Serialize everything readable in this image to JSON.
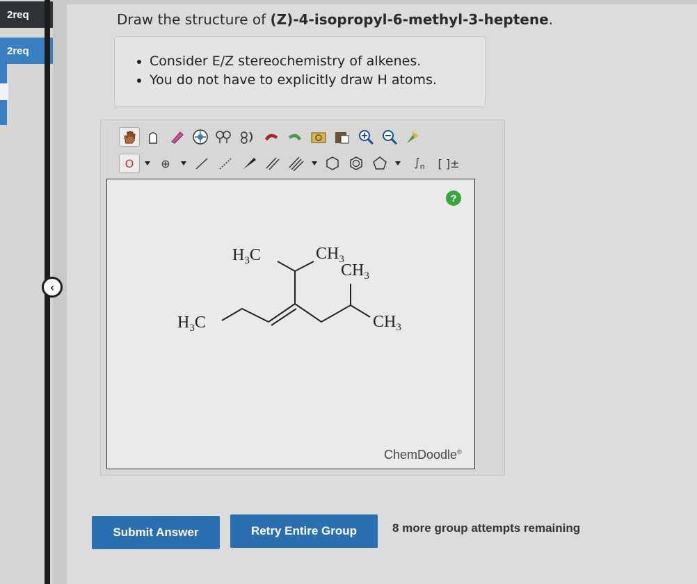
{
  "sidebar": {
    "items": [
      {
        "label": "2req"
      },
      {
        "label": "2req"
      }
    ],
    "collapse_icon": "chevron-left-icon"
  },
  "question": {
    "prefix": "Draw the structure of ",
    "compound": "(Z)-4-isopropyl-6-methyl-3-heptene",
    "suffix": "."
  },
  "hints": [
    "Consider E/Z stereochemistry of alkenes.",
    "You do not have to explicitly draw H atoms."
  ],
  "toolbar": {
    "row1_icons": [
      "hand-icon",
      "lasso-icon",
      "eraser-icon",
      "center-icon",
      "cleanup-icon",
      "flip-icon",
      "undo-icon",
      "redo-icon",
      "copy-icon",
      "template-icon",
      "zoom-in-icon",
      "zoom-out-icon",
      "settings-icon"
    ],
    "atom_label": "O",
    "charge_label": "⊕",
    "bond_icons": [
      "single-bond-icon",
      "dashed-bond-icon",
      "wedge-bond-icon",
      "double-bond-icon",
      "triple-bond-icon"
    ],
    "ring_icons": [
      "cyclohexane-icon",
      "benzene-icon",
      "cyclopentane-icon"
    ],
    "repeat_label": "n",
    "bracket_label": "[ ]±"
  },
  "molecule": {
    "labels": {
      "h3c_left": "H3C",
      "h3c_top": "H3C",
      "ch3_top_a": "CH3",
      "ch3_top_b": "CH3",
      "ch3_right": "CH3"
    }
  },
  "help_label": "?",
  "brand": "ChemDoodle",
  "brand_mark": "®",
  "buttons": {
    "submit": "Submit Answer",
    "retry": "Retry Entire Group"
  },
  "attempts_text": "8 more group attempts remaining",
  "colors": {
    "button_blue": "#2c6fb0",
    "help_green": "#3aa43f"
  }
}
